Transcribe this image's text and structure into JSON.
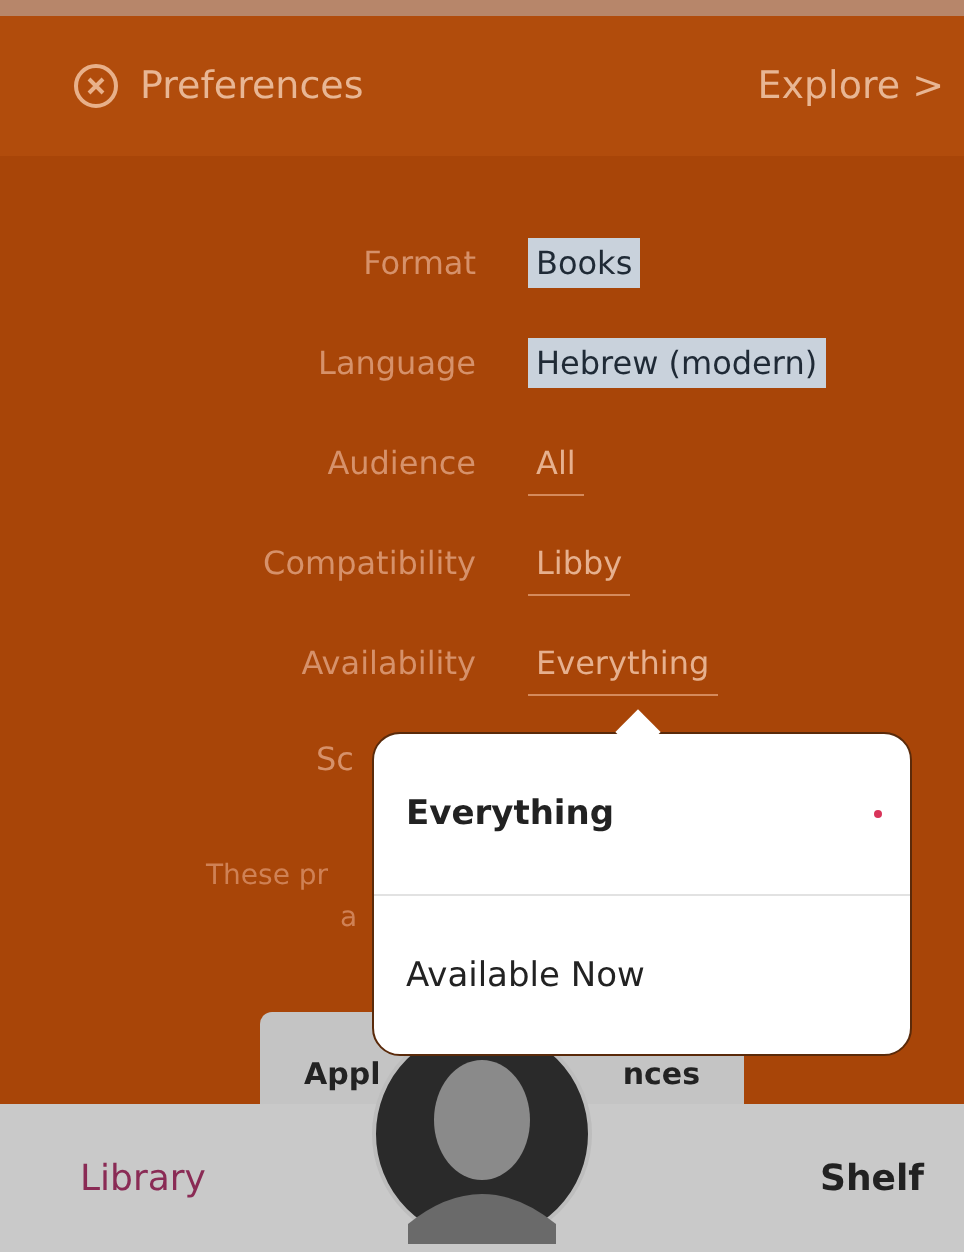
{
  "header": {
    "title": "Preferences",
    "explore": "Explore",
    "explore_arrow": ">"
  },
  "fields": [
    {
      "label": "Format",
      "value": "Books",
      "highlighted": true
    },
    {
      "label": "Language",
      "value": "Hebrew (modern)",
      "highlighted": true
    },
    {
      "label": "Audience",
      "value": "All",
      "highlighted": false
    },
    {
      "label": "Compatibility",
      "value": "Libby",
      "highlighted": false
    },
    {
      "label": "Availability",
      "value": "Everything",
      "highlighted": false
    }
  ],
  "sort_label": "Sc",
  "note_lines": [
    "These pr",
    "a"
  ],
  "apply_button": {
    "label_start": "Appl",
    "label_end": "nces"
  },
  "popup": {
    "options": [
      {
        "label": "Everything",
        "selected": true
      },
      {
        "label": "Available Now",
        "selected": false
      }
    ]
  },
  "nav": {
    "items": [
      {
        "label": "Library",
        "selected": true
      },
      {
        "label": "Shelf",
        "selected": false
      }
    ]
  }
}
